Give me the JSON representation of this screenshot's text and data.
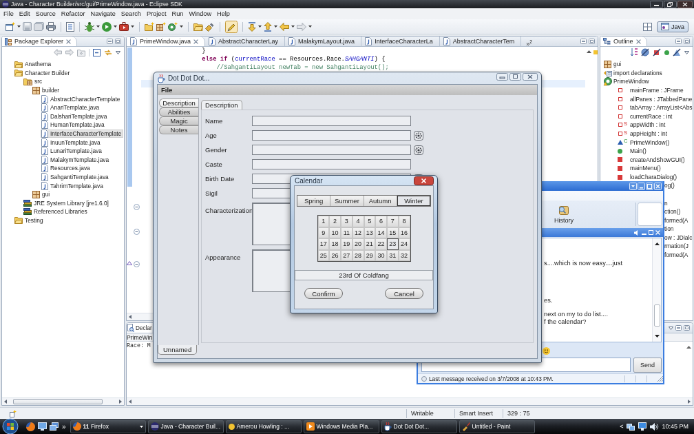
{
  "eclipse": {
    "title": "Java - Character Builder/src/gui/PrimeWindow.java - Eclipse SDK",
    "menu": [
      "File",
      "Edit",
      "Source",
      "Refactor",
      "Navigate",
      "Search",
      "Project",
      "Run",
      "Window",
      "Help"
    ],
    "toolbar": {
      "highlight_toggle": {
        "pressed": true
      }
    },
    "perspectives": [
      {
        "label": "Java",
        "selected": true
      }
    ]
  },
  "package_explorer": {
    "title": "Package Explorer",
    "tree": [
      {
        "label": "Anathema",
        "kind": "project",
        "selected": false
      },
      {
        "label": "Character Builder",
        "kind": "project",
        "selected": false,
        "children": [
          {
            "label": "src",
            "kind": "source-folder",
            "selected": false,
            "children": [
              {
                "label": "builder",
                "kind": "package",
                "selected": false,
                "children": [
                  {
                    "label": "AbstractCharacterTemplate",
                    "kind": "java-file",
                    "selected": false
                  },
                  {
                    "label": "AnariTemplate.java",
                    "kind": "java-file",
                    "selected": false
                  },
                  {
                    "label": "DalshariTemplate.java",
                    "kind": "java-file",
                    "selected": false
                  },
                  {
                    "label": "HumanTemplate.java",
                    "kind": "java-file",
                    "selected": false
                  },
                  {
                    "label": "InterfaceCharacterTemplate",
                    "kind": "java-file",
                    "selected": true
                  },
                  {
                    "label": "InuunTemplate.java",
                    "kind": "java-file",
                    "selected": false
                  },
                  {
                    "label": "LunariTemplate.java",
                    "kind": "java-file",
                    "selected": false
                  },
                  {
                    "label": "MalakymTemplate.java",
                    "kind": "java-file",
                    "selected": false
                  },
                  {
                    "label": "Resources.java",
                    "kind": "java-file",
                    "selected": false
                  },
                  {
                    "label": "SahgantiTemplate.java",
                    "kind": "java-file",
                    "selected": false
                  },
                  {
                    "label": "TahrimTemplate.java",
                    "kind": "java-file",
                    "selected": false
                  }
                ]
              },
              {
                "label": "gui",
                "kind": "package",
                "selected": false
              }
            ]
          },
          {
            "label": "JRE System Library [jre1.6.0]",
            "kind": "library",
            "selected": false
          },
          {
            "label": "Referenced Libraries",
            "kind": "library",
            "selected": false
          }
        ]
      },
      {
        "label": "Testing",
        "kind": "project",
        "selected": false
      }
    ]
  },
  "editor": {
    "tabs": [
      {
        "label": "PrimeWindow.java",
        "selected": true
      },
      {
        "label": "AbstractCharacterLay",
        "selected": false
      },
      {
        "label": "MalakymLayout.java",
        "selected": false
      },
      {
        "label": "InterfaceCharacterLa",
        "selected": false
      },
      {
        "label": "AbstractCharacterTem",
        "selected": false
      }
    ],
    "overflow": "»$^{2}$",
    "code": [
      [
        {
          "text": "                }",
          "kind": "plain"
        }
      ],
      [
        {
          "text": "                else if",
          "kind": "keyword"
        },
        {
          "text": " (",
          "kind": "plain"
        },
        {
          "text": "currentRace",
          "kind": "field"
        },
        {
          "text": " == Resources.Race.",
          "kind": "plain"
        },
        {
          "text": "SAHGANTI",
          "kind": "static"
        },
        {
          "text": ") {",
          "kind": "plain"
        }
      ],
      [
        {
          "text": "                    //SahgantiLayout newTab = new SahgantiLayout();",
          "kind": "comment"
        }
      ]
    ]
  },
  "outline": {
    "title": "Outline",
    "tree": [
      {
        "label": "gui",
        "kind": "package"
      },
      {
        "label": "import declarations",
        "kind": "imports"
      },
      {
        "label": "PrimeWindow",
        "kind": "class",
        "children": [
          {
            "label": "mainFrame : JFrame",
            "kind": "field"
          },
          {
            "label": "allPanes : JTabbedPane",
            "kind": "field"
          },
          {
            "label": "tabArray : ArrayList<Abs",
            "kind": "field"
          },
          {
            "label": "currentRace : int",
            "kind": "field"
          },
          {
            "label": "appWidth : int",
            "kind": "field",
            "modifier": "S"
          },
          {
            "label": "appHeight : int",
            "kind": "field",
            "modifier": "S"
          },
          {
            "label": "PrimeWindow()",
            "kind": "constructor",
            "modifier": "C"
          },
          {
            "label": "Main()",
            "kind": "public-method"
          },
          {
            "label": "createAndShowGUI()",
            "kind": "private-method"
          },
          {
            "label": "mainMenu()",
            "kind": "private-method"
          },
          {
            "label": "loadCharaDialog()",
            "kind": "private-method"
          }
        ]
      }
    ],
    "clipped_rows": [
      "og()",
      "n",
      "ction()",
      "formed(A",
      "tion",
      "ow : JDialc",
      "rmation(J",
      "formed(A"
    ]
  },
  "declaration": {
    "tab": "Declar",
    "element": "PrimeWin",
    "source": "Race: M"
  },
  "status_bar": {
    "fields": [
      "Writable",
      "Smart Insert",
      "329 : 75"
    ]
  },
  "messenger": {
    "toolbar": [
      {
        "label": "History"
      }
    ],
    "messages": [
      "s....which is now easy....just",
      "es.",
      "next on my to do list....",
      "f the calendar?"
    ],
    "send": "Send",
    "status": "Last message received on 3/7/2008 at 10:43 PM."
  },
  "dot_window": {
    "title": "Dot Dot Dot...",
    "menu": [
      "File"
    ],
    "side_tabs": [
      {
        "label": "Description",
        "selected": true
      },
      {
        "label": "Abilities",
        "selected": false
      },
      {
        "label": "Magic",
        "selected": false
      },
      {
        "label": "Notes",
        "selected": false
      }
    ],
    "tabs": [
      {
        "label": "Description",
        "selected": true
      }
    ],
    "fields": [
      {
        "label": "Name",
        "kind": "line",
        "button": false
      },
      {
        "label": "Age",
        "kind": "line",
        "button": true
      },
      {
        "label": "Gender",
        "kind": "line",
        "button": true
      },
      {
        "label": "Caste",
        "kind": "line",
        "button": false
      },
      {
        "label": "Birth Date",
        "kind": "line",
        "button": true
      },
      {
        "label": "Sigil",
        "kind": "line"
      },
      {
        "label": "Characterization",
        "kind": "area"
      },
      {
        "label": "Appearance",
        "kind": "area"
      }
    ],
    "bottom_tabs": [
      {
        "label": "Unnamed",
        "selected": true
      }
    ]
  },
  "calendar": {
    "title": "Calendar",
    "seasons": [
      {
        "label": "Spring",
        "selected": false
      },
      {
        "label": "Summer",
        "selected": false
      },
      {
        "label": "Autumn",
        "selected": false
      },
      {
        "label": "Winter",
        "selected": true
      }
    ],
    "days": [
      {
        "label": "1",
        "selected": false
      },
      {
        "label": "2",
        "selected": false
      },
      {
        "label": "3",
        "selected": false
      },
      {
        "label": "4",
        "selected": false
      },
      {
        "label": "5",
        "selected": false
      },
      {
        "label": "6",
        "selected": false
      },
      {
        "label": "7",
        "selected": false
      },
      {
        "label": "8",
        "selected": false
      },
      {
        "label": "9",
        "selected": false
      },
      {
        "label": "10",
        "selected": false
      },
      {
        "label": "11",
        "selected": false
      },
      {
        "label": "12",
        "selected": false
      },
      {
        "label": "13",
        "selected": false
      },
      {
        "label": "14",
        "selected": false
      },
      {
        "label": "15",
        "selected": false
      },
      {
        "label": "16",
        "selected": false
      },
      {
        "label": "17",
        "selected": false
      },
      {
        "label": "18",
        "selected": false
      },
      {
        "label": "19",
        "selected": false
      },
      {
        "label": "20",
        "selected": false
      },
      {
        "label": "21",
        "selected": false
      },
      {
        "label": "22",
        "selected": false
      },
      {
        "label": "23",
        "selected": true
      },
      {
        "label": "24",
        "selected": false
      },
      {
        "label": "25",
        "selected": false
      },
      {
        "label": "26",
        "selected": false
      },
      {
        "label": "27",
        "selected": false
      },
      {
        "label": "28",
        "selected": false
      },
      {
        "label": "29",
        "selected": false
      },
      {
        "label": "30",
        "selected": false
      },
      {
        "label": "31",
        "selected": false
      },
      {
        "label": "32",
        "selected": false
      }
    ],
    "date": "23rd Of Coldfang",
    "buttons": [
      "Confirm",
      "Cancel"
    ]
  },
  "taskbar": {
    "more": "»",
    "tasks": [
      {
        "label": "**11** Firefox",
        "grouped": true
      },
      {
        "label": "Java - Character Buil...",
        "grouped": false
      },
      {
        "label": "Amerou Howling : ...",
        "grouped": false
      },
      {
        "label": "Windows Media Pla...",
        "grouped": false
      },
      {
        "label": "Dot Dot Dot...",
        "grouped": false
      },
      {
        "label": "Untitled - Paint",
        "grouped": false
      }
    ],
    "tray_expand": "<",
    "clock": "10:45 PM"
  }
}
